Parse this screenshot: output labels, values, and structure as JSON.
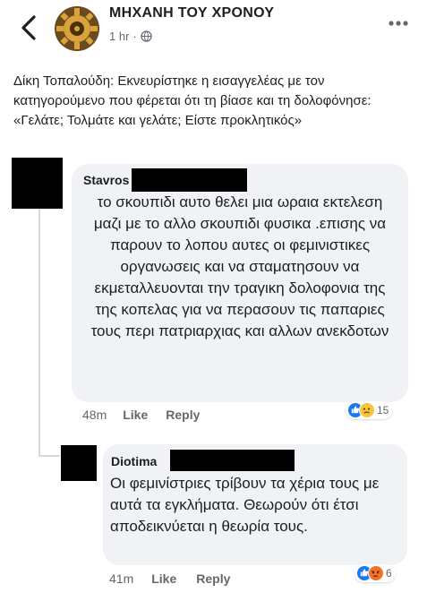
{
  "header": {
    "page_name": "ΜΗΧΑΝΗ ΤΟΥ ΧΡΟΝΟΥ",
    "time": "1 hr",
    "separator": "·"
  },
  "post": {
    "text": "Δίκη Τοπαλούδη: Εκνευρίστηκε η εισαγγελέας με τον κατηγορούμενο που φέρεται ότι τη βίασε και τη δολοφόνησε: «Γελάτε; Τολμάτε και γελάτε; Είστε προκλητικός»"
  },
  "comments": [
    {
      "author": "Stavros",
      "text": "το σκουπιδι αυτο θελει μια ωραια εκτελεση μαζι με το αλλο σκουπιδι φυσικα .επισης να παρουν το λοπου αυτες οι φεμινιστικες οργανωσεις και να σταματησουν να εκμεταλλευονται την τραγικη δολοφονια της της κοπελας για να περασουν τις παπαριες τους περι πατριαρχιας και αλλων ανεκδοτων",
      "time": "48m",
      "like_label": "Like",
      "reply_label": "Reply",
      "reaction_icons": [
        "like-icon",
        "sad-icon"
      ],
      "reaction_count": "15"
    },
    {
      "author": "Diotima",
      "text": "Οι φεμινίστριες τρίβουν τα χέρια τους με αυτά τα εγκλήματα. Θεωρούν ότι έτσι αποδεικνύεται η θεωρία τους.",
      "time": "41m",
      "like_label": "Like",
      "reply_label": "Reply",
      "reaction_icons": [
        "like-icon",
        "angry-icon"
      ],
      "reaction_count": "6"
    }
  ],
  "colors": {
    "like_blue": "#1877f2",
    "sad_yellow": "#f7c43a",
    "angry_orange": "#f0712a",
    "bubble_bg": "#f0f2f5",
    "meta_grey": "#65676b"
  }
}
